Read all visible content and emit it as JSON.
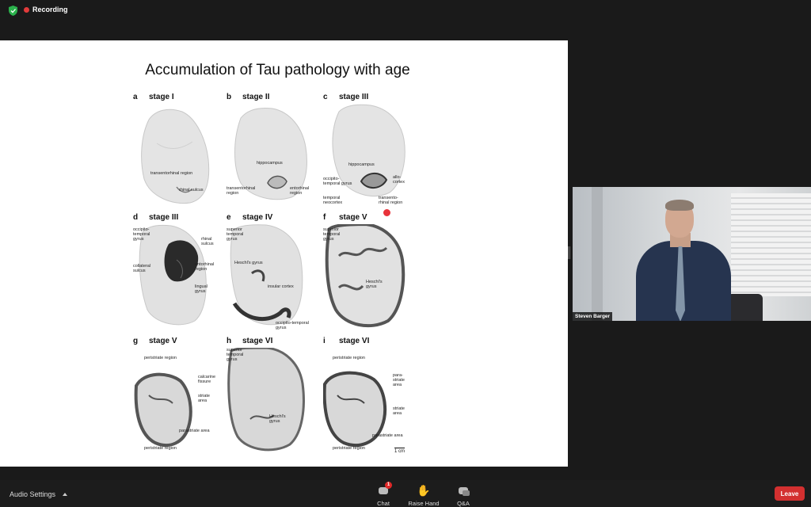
{
  "topbar": {
    "recording_label": "Recording"
  },
  "slide": {
    "title": "Accumulation of Tau pathology with age",
    "panels": [
      {
        "letter": "a",
        "stage": "stage I",
        "labels": [
          "transentorhinal region",
          "rhinal sulcus"
        ]
      },
      {
        "letter": "b",
        "stage": "stage II",
        "labels": [
          "hippocampus",
          "transentorhinal\nregion",
          "entorhinal\nregion"
        ]
      },
      {
        "letter": "c",
        "stage": "stage III",
        "labels": [
          "hippocampus",
          "occipito-\ntemporal gyrus",
          "allo-\ncortex",
          "temporal\nneocortex",
          "transento-\nrhinal region"
        ]
      },
      {
        "letter": "d",
        "stage": "stage III",
        "labels": [
          "occipito-\ntemporal\ngyrus",
          "rhinal\nsulcus",
          "collateral\nsulcus",
          "entorhinal\nregion",
          "lingual\ngyrus"
        ]
      },
      {
        "letter": "e",
        "stage": "stage IV",
        "labels": [
          "superior\ntemporal\ngyrus",
          "Heschl's gyrus",
          "insular cortex",
          "occipito-temporal\ngyrus"
        ]
      },
      {
        "letter": "f",
        "stage": "stage V",
        "labels": [
          "superior\ntemporal\ngyrus",
          "Heschl's\ngyrus"
        ]
      },
      {
        "letter": "g",
        "stage": "stage V",
        "labels": [
          "peristriate region",
          "calcarine\nfissure",
          "striate\narea",
          "parastriate area",
          "peristriate region"
        ]
      },
      {
        "letter": "h",
        "stage": "stage VI",
        "labels": [
          "superior\ntemporal\ngyrus",
          "Heschl's\ngyrus"
        ]
      },
      {
        "letter": "i",
        "stage": "stage VI",
        "labels": [
          "peristriate region",
          "para-\nstriate\narea",
          "striate\narea",
          "parastriate area",
          "peristriate region"
        ]
      }
    ],
    "scale_label": "1 cm"
  },
  "video": {
    "participant_name": "Steven Barger"
  },
  "toolbar": {
    "audio_settings_label": "Audio Settings",
    "chat_label": "Chat",
    "chat_badge": "1",
    "raise_hand_label": "Raise Hand",
    "qa_label": "Q&A",
    "leave_label": "Leave"
  },
  "colors": {
    "leave": "#d33030",
    "recording_dot": "#e23b3b",
    "shield": "#2bb24c"
  }
}
